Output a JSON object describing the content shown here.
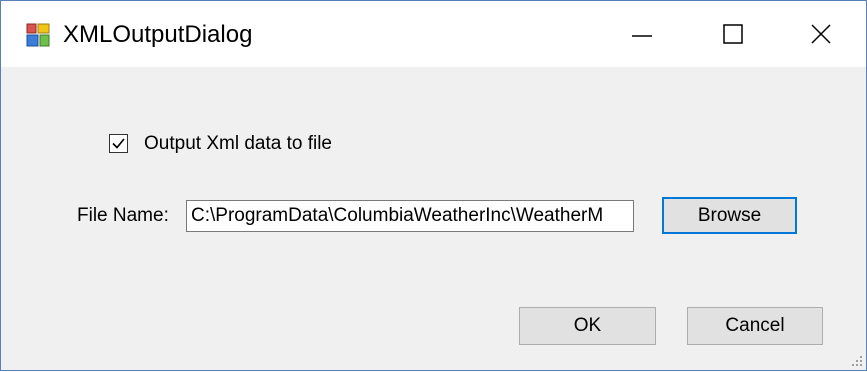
{
  "window": {
    "title": "XMLOutputDialog",
    "icon": "app-window-icon",
    "controls": {
      "minimize_icon": "minimize-icon",
      "maximize_icon": "maximize-icon",
      "close_icon": "close-icon"
    }
  },
  "form": {
    "output_checkbox": {
      "label": "Output Xml data to file",
      "checked": true
    },
    "file_name": {
      "label": "File Name:",
      "value": "C:\\ProgramData\\ColumbiaWeatherInc\\WeatherM"
    },
    "browse_label": "Browse"
  },
  "footer": {
    "ok_label": "OK",
    "cancel_label": "Cancel"
  },
  "colors": {
    "window_border": "#5a7fb8",
    "dialog_background": "#f0f0f0",
    "button_face": "#e1e1e1",
    "focus_accent": "#0078d7"
  }
}
